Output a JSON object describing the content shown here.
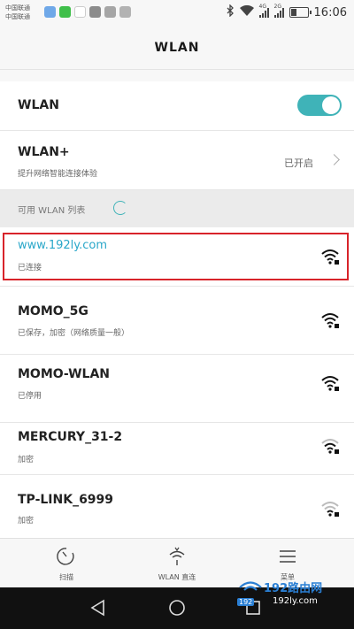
{
  "status_bar": {
    "carrier_line1": "中国联通",
    "carrier_line2": "中国联通",
    "net_label_1": "4G",
    "net_label_2": "2G",
    "time": "16:06"
  },
  "header": {
    "title": "WLAN"
  },
  "settings": {
    "wlan_label": "WLAN",
    "wlan_enabled": true,
    "wlan_plus_label": "WLAN+",
    "wlan_plus_desc": "提升网络智能连接体验",
    "wlan_plus_status": "已开启"
  },
  "available_list": {
    "header": "可用 WLAN 列表",
    "networks": [
      {
        "ssid": "www.192ly.com",
        "status": "已连接",
        "connected": true,
        "signal_icon": "wifi-lock-full-icon"
      },
      {
        "ssid": "MOMO_5G",
        "status": "已保存，加密（网络质量一般）",
        "connected": false,
        "signal_icon": "wifi-lock-full-icon"
      },
      {
        "ssid": "MOMO-WLAN",
        "status": "已停用",
        "connected": false,
        "signal_icon": "wifi-lock-full-icon"
      },
      {
        "ssid": "MERCURY_31-2",
        "status": "加密",
        "connected": false,
        "signal_icon": "wifi-lock-medium-icon"
      },
      {
        "ssid": "TP-LINK_6999",
        "status": "加密",
        "connected": false,
        "signal_icon": "wifi-lock-weak-icon"
      }
    ]
  },
  "bottom_nav": {
    "scan": "扫描",
    "direct": "WLAN 直连",
    "more": "菜单"
  },
  "watermark": {
    "text": "192路由网",
    "url": "192ly.com",
    "badge": "192"
  },
  "colors": {
    "accent": "#3fb3b8",
    "link": "#2aa7c9",
    "highlight_border": "#d8232a"
  }
}
